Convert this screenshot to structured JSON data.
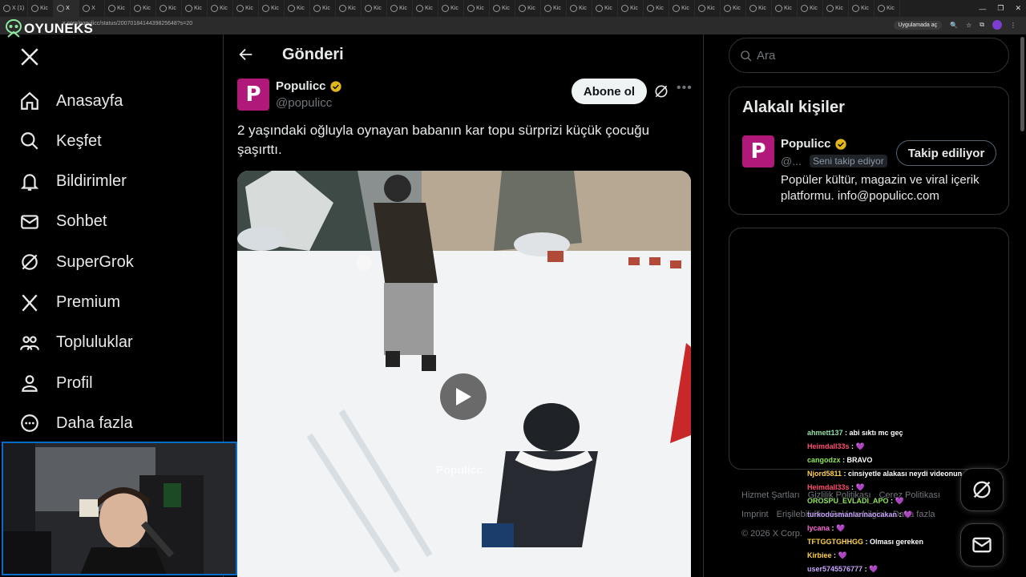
{
  "browser": {
    "tabs": [
      "X (1)",
      "Kic",
      "X",
      "X",
      "Kic",
      "Kic",
      "Kic",
      "Kic",
      "Kic",
      "Kic",
      "Kic",
      "Kic",
      "Kic",
      "Kic",
      "Kic",
      "Kic",
      "Kic",
      "Kic",
      "Kic",
      "Kic",
      "Kic",
      "Kic",
      "Kic",
      "Kic",
      "Kic",
      "Kic",
      "Kic",
      "Kic",
      "Kic",
      "Kic",
      "Kic",
      "Kic",
      "Kic",
      "Kic",
      "Kic"
    ],
    "url": "x.com/populicc/status/2007018414439825648?s=20",
    "open_in_app": "Uygulamada aç"
  },
  "overlay_brand": "OYUNEKS",
  "nav": {
    "items": [
      {
        "label": "Anasayfa",
        "icon": "home-icon"
      },
      {
        "label": "Keşfet",
        "icon": "search-icon"
      },
      {
        "label": "Bildirimler",
        "icon": "bell-icon"
      },
      {
        "label": "Sohbet",
        "icon": "mail-icon"
      },
      {
        "label": "SuperGrok",
        "icon": "grok-icon"
      },
      {
        "label": "Premium",
        "icon": "x-icon"
      },
      {
        "label": "Topluluklar",
        "icon": "people-icon"
      },
      {
        "label": "Profil",
        "icon": "person-icon"
      },
      {
        "label": "Daha fazla",
        "icon": "more-circle-icon"
      }
    ]
  },
  "post": {
    "header_title": "Gönderi",
    "author_name": "Populicc",
    "author_handle": "@populicc",
    "subscribe_label": "Abone ol",
    "text": "2 yaşındaki oğluyla oynayan babanın kar topu sürprizi küçük çocuğu şaşırttı.",
    "watermark": "Populicc"
  },
  "sidebar": {
    "search_placeholder": "Ara",
    "relevant_title": "Alakalı kişiler",
    "relevant_name": "Populicc",
    "relevant_handle": "@...",
    "follows_you": "Seni takip ediyor",
    "following_label": "Takip ediliyor",
    "relevant_bio": "Popüler kültür, magazin ve viral içerik platformu. info@populicc.com",
    "footer_links": [
      "Hizmet Şartları",
      "Gizlilik Politikası",
      "Çerez Politikası",
      "Imprint",
      "Erişilebilirlik",
      "Reklam bilgisi",
      "Daha fazla"
    ],
    "copyright": "© 2026 X Corp."
  },
  "chat": [
    {
      "user": "ahmett137",
      "msg": "abi sıktı mc geç",
      "color": "#8fe0a8"
    },
    {
      "user": "Heimdall33s",
      "msg": "💜",
      "color": "#ff4d6d"
    },
    {
      "user": "cangodzx",
      "msg": "BRAVO",
      "color": "#8fe35a"
    },
    {
      "user": "Njord5811",
      "msg": "cinsiyetle alakası neydi videonun",
      "color": "#ffd24a"
    },
    {
      "user": "Heimdall33s",
      "msg": "💜",
      "color": "#ff4d6d"
    },
    {
      "user": "OROSPU_EVLADI_APO",
      "msg": "💜",
      "color": "#8fe35a"
    },
    {
      "user": "turkodusmanlarinaocakan",
      "msg": "💜",
      "color": "#c9a6ff"
    },
    {
      "user": "lycana",
      "msg": "💜",
      "color": "#ff6ad5"
    },
    {
      "user": "TFTGGTGHHGG",
      "msg": "Olması gereken",
      "color": "#ffd24a"
    },
    {
      "user": "Kirbiee",
      "msg": "💜",
      "color": "#ffd24a"
    },
    {
      "user": "user5745576777",
      "msg": "💜",
      "color": "#c9a6ff"
    }
  ],
  "colors": {
    "accent_verified": "#e2b719",
    "avatar_brand": "#b0197a",
    "webcam_border": "#0b6cc7"
  }
}
